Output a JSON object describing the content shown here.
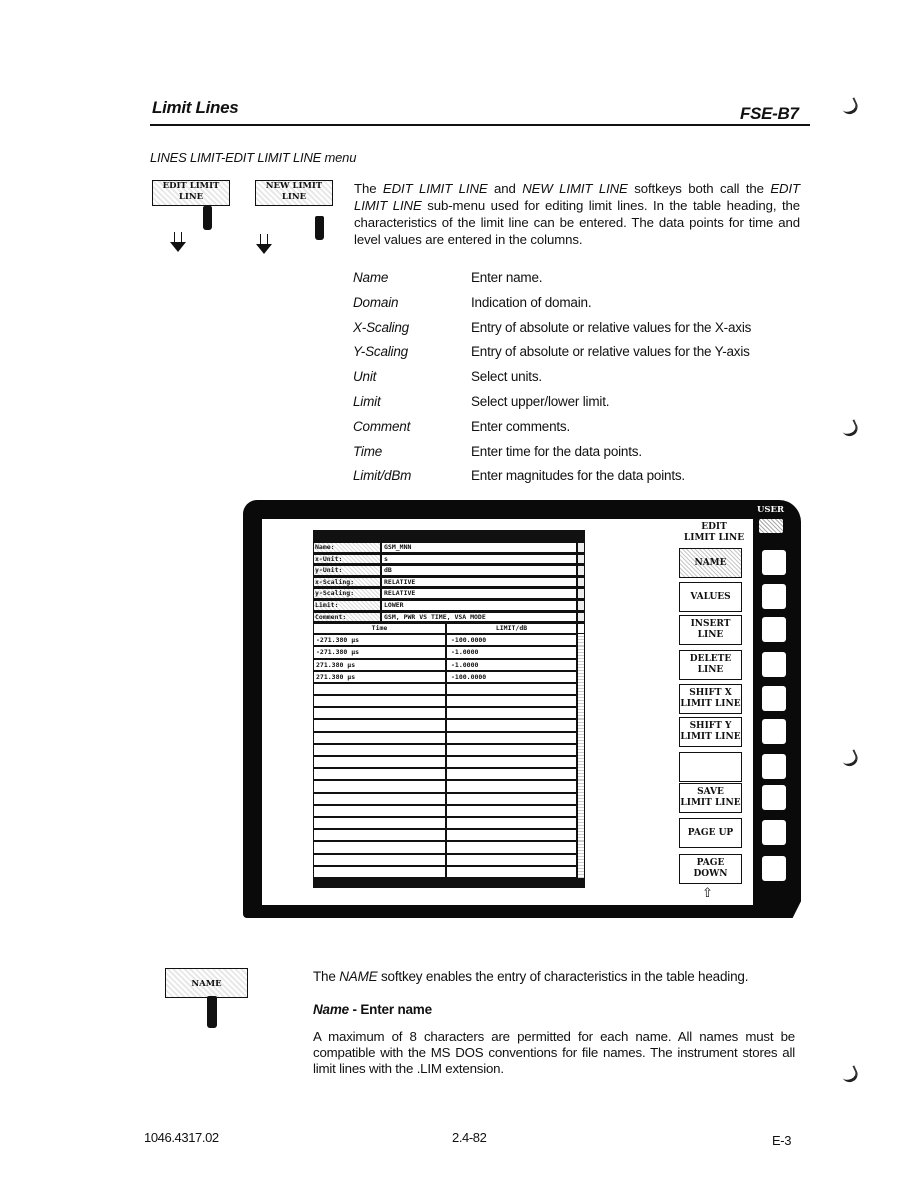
{
  "header": {
    "title": "Limit Lines",
    "model": "FSE-B7"
  },
  "menu_path": "LINES LIMIT-EDIT LIMIT LINE menu",
  "softkey_icons": {
    "edit_limit_line": "EDIT LIMIT\nLINE",
    "new_limit_line": "NEW LIMIT\nLINE",
    "name": "NAME"
  },
  "intro": {
    "p1": "The ",
    "k1": "EDIT LIMIT LINE",
    "p2": " and ",
    "k2": "NEW LIMIT LINE",
    "p3": " softkeys both call the ",
    "k3": "EDIT LIMIT LINE",
    "p4": " sub-menu used for editing limit lines. In the table heading, the characteristics of the limit line can be entered. The data points for time and level values are entered in the columns."
  },
  "definitions": [
    {
      "term": "Name",
      "desc": "Enter name."
    },
    {
      "term": "Domain",
      "desc": "Indication of domain."
    },
    {
      "term": "X-Scaling",
      "desc": "Entry of absolute or relative values for the X-axis"
    },
    {
      "term": "Y-Scaling",
      "desc": "Entry of absolute or relative values for the Y-axis"
    },
    {
      "term": "Unit",
      "desc": "Select units."
    },
    {
      "term": "Limit",
      "desc": "Select upper/lower limit."
    },
    {
      "term": "Comment",
      "desc": "Enter comments."
    },
    {
      "term": "Time",
      "desc": "Enter time for the data points."
    },
    {
      "term": "Limit/dBm",
      "desc": "Enter magnitudes for the data points."
    }
  ],
  "screen": {
    "table_heading": [
      {
        "label": "Name:",
        "value": "GSM_MNN"
      },
      {
        "label": "x-Unit:",
        "value": "s"
      },
      {
        "label": "y-Unit:",
        "value": "dB"
      },
      {
        "label": "x-Scaling:",
        "value": "RELATIVE"
      },
      {
        "label": "y-Scaling:",
        "value": "RELATIVE"
      },
      {
        "label": "Limit:",
        "value": "LOWER"
      },
      {
        "label": "Comment:",
        "value": "GSM, PWR VS TIME, VSA MODE"
      }
    ],
    "columns": {
      "time": "Time",
      "limit": "LIMIT/dB"
    },
    "rows": [
      {
        "time": "-271.380 µs",
        "limit": "-100.0000"
      },
      {
        "time": "-271.380 µs",
        "limit": "-1.0000"
      },
      {
        "time": "271.380 µs",
        "limit": "-1.0000"
      },
      {
        "time": "271.380 µs",
        "limit": "-100.0000"
      },
      {
        "time": "",
        "limit": ""
      },
      {
        "time": "",
        "limit": ""
      },
      {
        "time": "",
        "limit": ""
      },
      {
        "time": "",
        "limit": ""
      },
      {
        "time": "",
        "limit": ""
      },
      {
        "time": "",
        "limit": ""
      },
      {
        "time": "",
        "limit": ""
      },
      {
        "time": "",
        "limit": ""
      },
      {
        "time": "",
        "limit": ""
      },
      {
        "time": "",
        "limit": ""
      },
      {
        "time": "",
        "limit": ""
      },
      {
        "time": "",
        "limit": ""
      },
      {
        "time": "",
        "limit": ""
      },
      {
        "time": "",
        "limit": ""
      },
      {
        "time": "",
        "limit": ""
      },
      {
        "time": "",
        "limit": ""
      }
    ],
    "user_label": "USER",
    "menu_title": "EDIT\nLIMIT LINE",
    "softkeys": [
      {
        "label": "NAME",
        "active": true
      },
      {
        "label": "VALUES",
        "active": false
      },
      {
        "label": "INSERT\nLINE",
        "active": false
      },
      {
        "label": "DELETE\nLINE",
        "active": false
      },
      {
        "label": "SHIFT X\nLIMIT LINE",
        "active": false
      },
      {
        "label": "SHIFT Y\nLIMIT LINE",
        "active": false
      },
      {
        "label": "",
        "active": false
      },
      {
        "label": "SAVE\nLIMIT LINE",
        "active": false
      },
      {
        "label": "PAGE UP",
        "active": false
      },
      {
        "label": "PAGE DOWN",
        "active": false
      }
    ],
    "up_arrow": "⇧"
  },
  "name_section": {
    "p1": "The ",
    "k1": "NAME",
    "p2": " softkey enables the entry of characteristics in the table heading.",
    "sub_term": "Name",
    "sub_desc": " - Enter name",
    "body": "A maximum of 8 characters are permitted for each name. All names must be compatible with the MS DOS conventions for file names. The instrument stores all limit lines with the .LIM extension."
  },
  "footer": {
    "doc_number": "1046.4317.02",
    "page": "2.4-82",
    "edition": "E-3"
  }
}
